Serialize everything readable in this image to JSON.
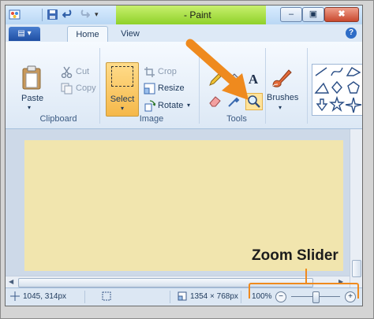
{
  "window": {
    "title": "- Paint",
    "min_glyph": "–",
    "max_glyph": "▣",
    "close_glyph": "✖",
    "qa_dropdown_glyph": "▾"
  },
  "tabs": {
    "file_glyph": "▤ ▾",
    "home": "Home",
    "view": "View",
    "help_glyph": "?"
  },
  "clipboard": {
    "paste": "Paste",
    "paste_arrow": "▾",
    "cut": "Cut",
    "copy": "Copy",
    "group_label": "Clipboard"
  },
  "image": {
    "select": "Select",
    "select_arrow": "▾",
    "crop": "Crop",
    "resize": "Resize",
    "rotate": "Rotate",
    "rotate_arrow": "▾",
    "group_label": "Image"
  },
  "tools": {
    "text_glyph": "A",
    "group_label": "Tools"
  },
  "brushes": {
    "label": "Brushes",
    "arrow": "▾"
  },
  "status": {
    "cursor_position": "1045, 314px",
    "image_size": "1354 × 768px",
    "zoom_level": "100%",
    "zoom_out": "−",
    "zoom_in": "+",
    "zoom_fraction": 0.5
  },
  "annotation": {
    "callout": "Zoom Slider"
  },
  "colors": {
    "accent_arrow": "#ef8a1e",
    "canvas": "#f1e5ae",
    "title_green": "#8fd12a"
  }
}
